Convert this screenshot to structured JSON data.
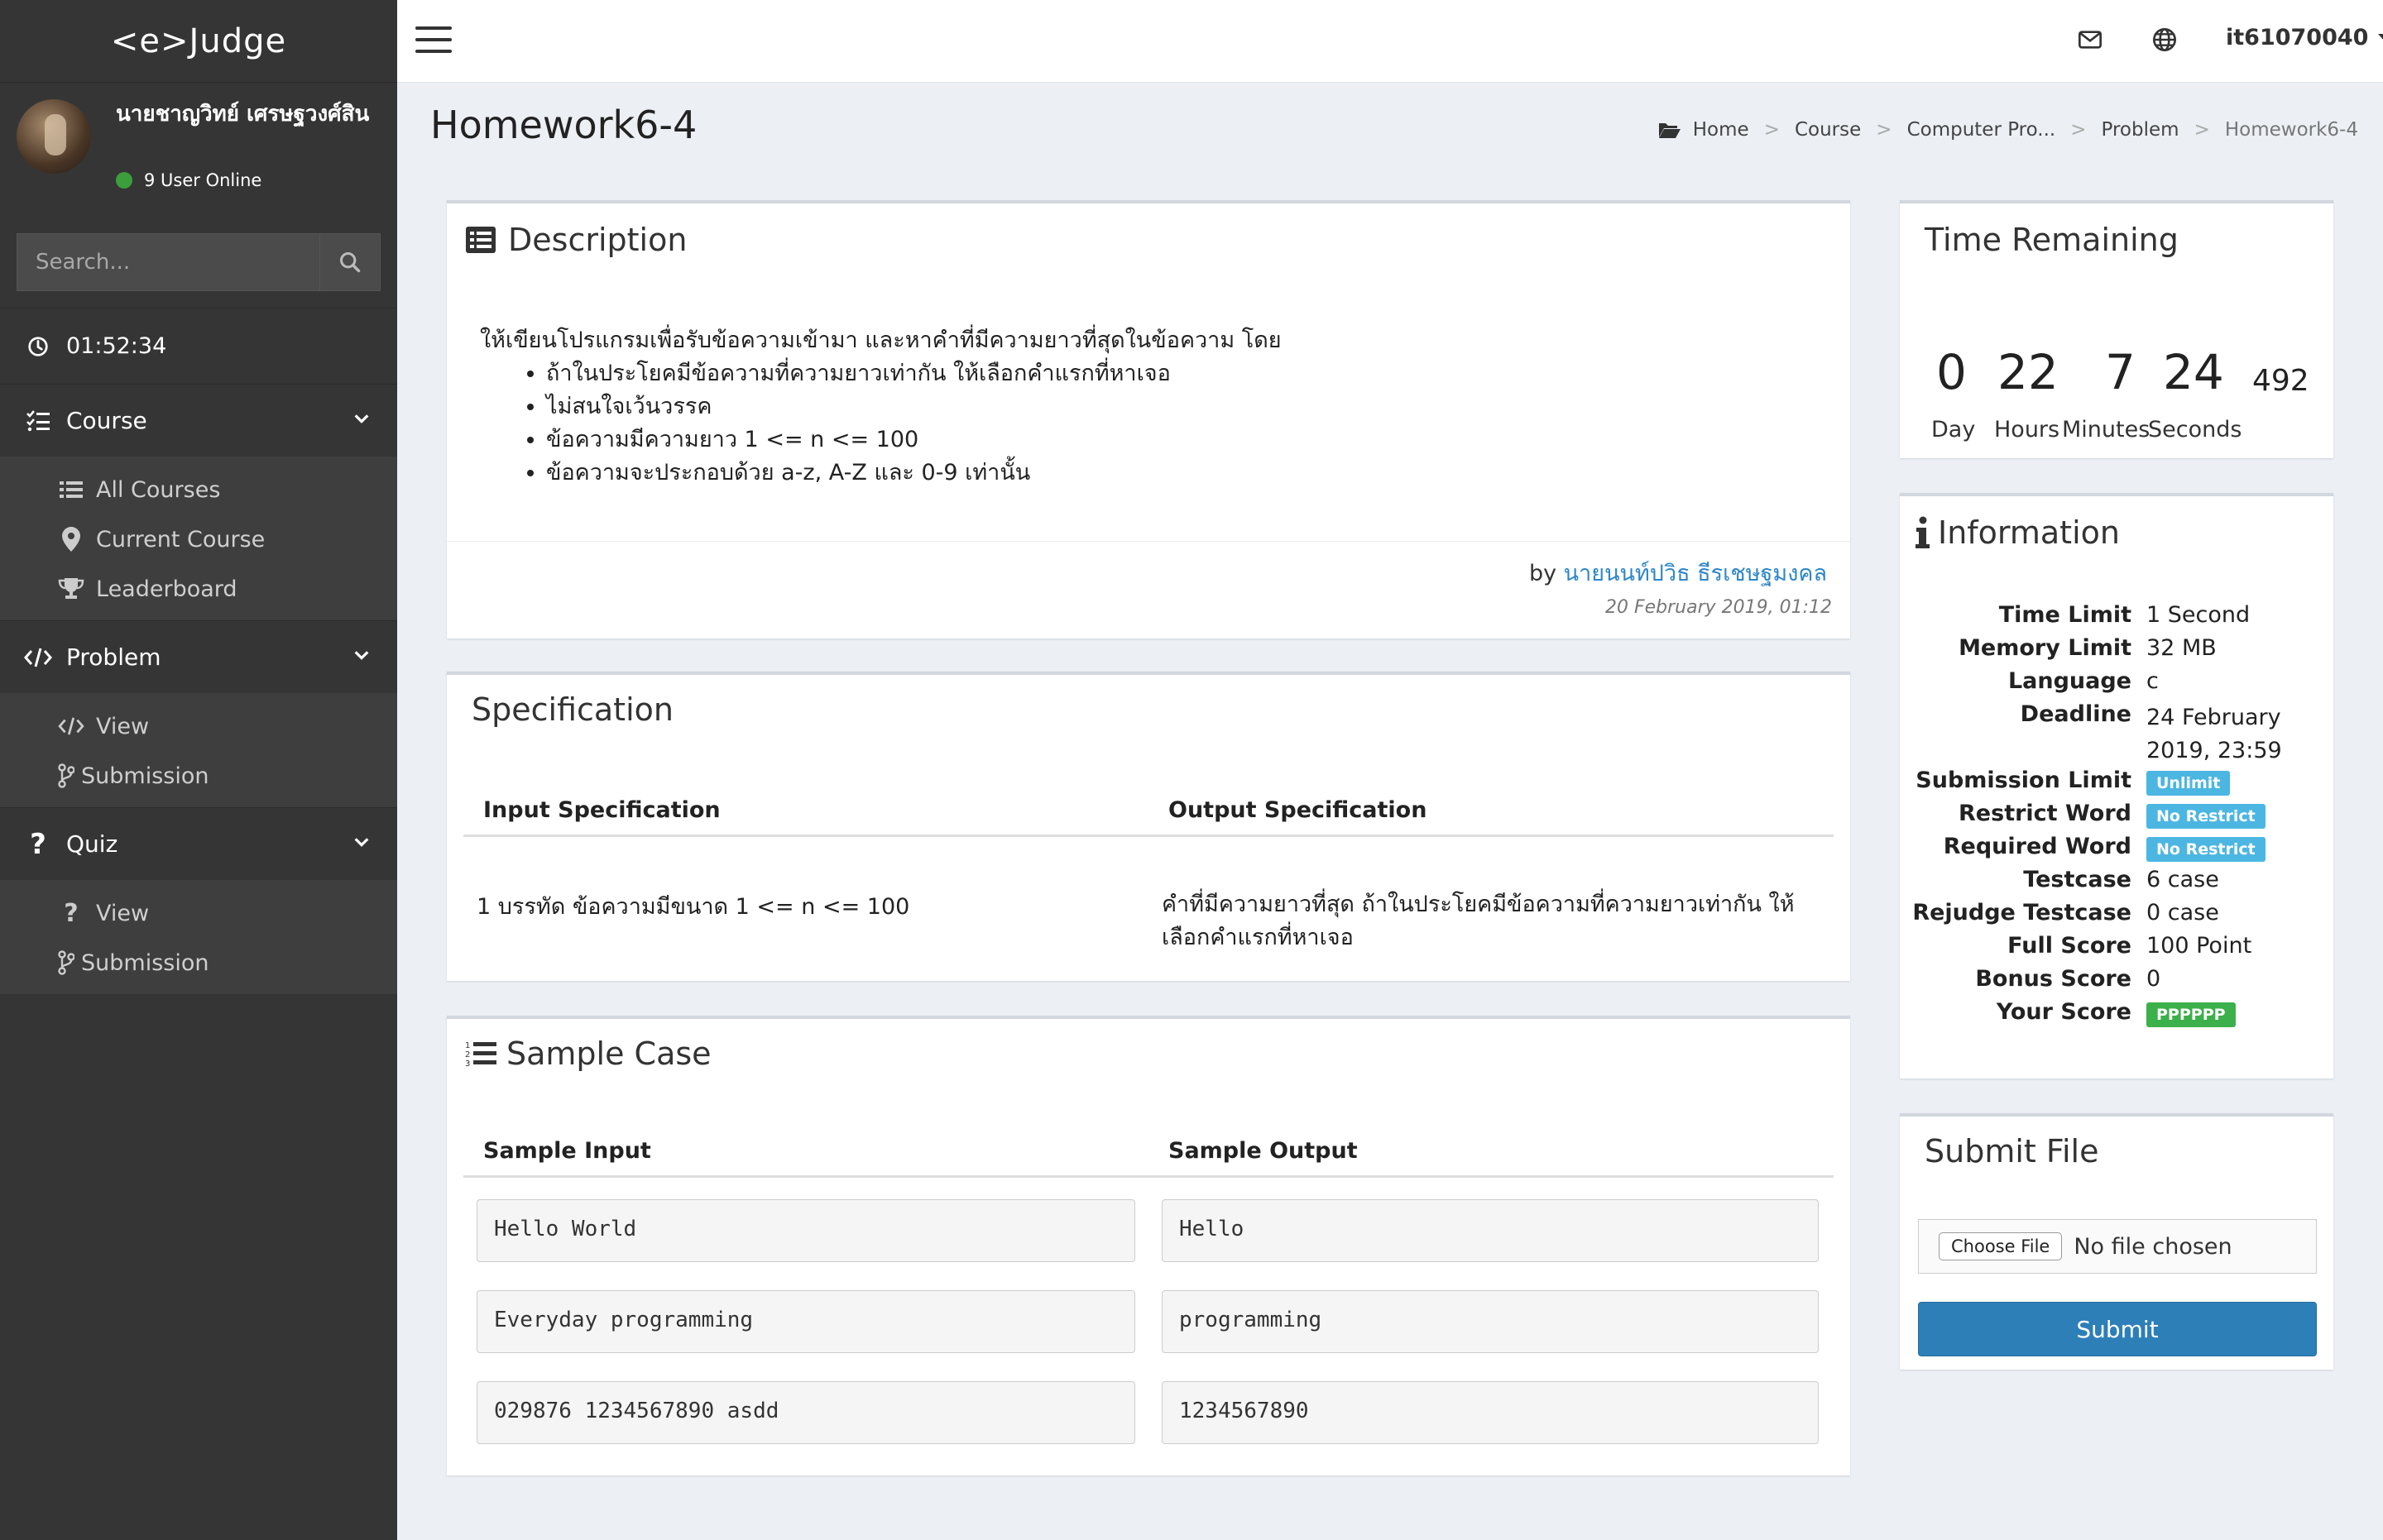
{
  "brand": {
    "logo": "<e>Judge"
  },
  "user": {
    "name": "นายชาญวิทย์ เศรษฐวงศ์สิน",
    "online_text": "9 User Online"
  },
  "search": {
    "placeholder": "Search..."
  },
  "sidebar": {
    "timer": "01:52:34",
    "sections": [
      {
        "label": "Course",
        "items": [
          "All Courses",
          "Current Course",
          "Leaderboard"
        ]
      },
      {
        "label": "Problem",
        "items": [
          "View",
          "Submission"
        ]
      },
      {
        "label": "Quiz",
        "items": [
          "View",
          "Submission"
        ]
      }
    ]
  },
  "topbar": {
    "username": "it61070040"
  },
  "page": {
    "title": "Homework6-4",
    "breadcrumb": [
      "Home",
      "Course",
      "Computer Pro...",
      "Problem",
      "Homework6-4"
    ]
  },
  "description": {
    "title": "Description",
    "intro": "ให้เขียนโปรแกรมเพื่อรับข้อความเข้ามา และหาคำที่มีความยาวที่สุดในข้อความ โดย",
    "bullets": [
      "ถ้าในประโยคมีข้อความที่ความยาวเท่ากัน ให้เลือกคำแรกที่หาเจอ",
      "ไม่สนใจเว้นวรรค",
      "ข้อความมีความยาว 1 <= n <= 100",
      "ข้อความจะประกอบด้วย a-z, A-Z และ 0-9 เท่านั้น"
    ],
    "by_prefix": "by",
    "author": "นายนนท์ปวิธ ธีรเชษฐมงคล",
    "date": "20 February 2019, 01:12"
  },
  "specification": {
    "title": "Specification",
    "input_header": "Input Specification",
    "output_header": "Output Specification",
    "input": "1 บรรทัด ข้อความมีขนาด 1 <= n <= 100",
    "output": "คำที่มีความยาวที่สุด ถ้าในประโยคมีข้อความที่ความยาวเท่ากัน ให้เลือกคำแรกที่หาเจอ"
  },
  "sample": {
    "title": "Sample Case",
    "input_header": "Sample Input",
    "output_header": "Sample Output",
    "cases": [
      {
        "input": "Hello World",
        "output": "Hello"
      },
      {
        "input": "Everyday programming",
        "output": "programming"
      },
      {
        "input": "029876 1234567890 asdd",
        "output": "1234567890"
      }
    ]
  },
  "time_remaining": {
    "title": "Time Remaining",
    "day": "0",
    "hours": "22",
    "minutes": "7",
    "seconds": "24",
    "ms": "492",
    "labels": {
      "day": "Day",
      "hours": "Hours",
      "minutes": "Minutes",
      "seconds": "Seconds"
    }
  },
  "information": {
    "title": "Information",
    "rows": [
      {
        "key": "Time Limit",
        "value": "1 Second"
      },
      {
        "key": "Memory Limit",
        "value": "32 MB"
      },
      {
        "key": "Language",
        "value": "c"
      },
      {
        "key": "Deadline",
        "value": "24 February 2019, 23:59"
      },
      {
        "key": "Submission Limit",
        "value": "Unlimit"
      },
      {
        "key": "Restrict Word",
        "value": "No Restrict"
      },
      {
        "key": "Required Word",
        "value": "No Restrict"
      },
      {
        "key": "Testcase",
        "value": "6 case"
      },
      {
        "key": "Rejudge Testcase",
        "value": "0 case"
      },
      {
        "key": "Full Score",
        "value": "100 Point"
      },
      {
        "key": "Bonus Score",
        "value": "0"
      },
      {
        "key": "Your Score",
        "value": "PPPPPP"
      }
    ]
  },
  "submit": {
    "title": "Submit File",
    "choose_label": "Choose File",
    "no_file": "No file chosen",
    "button": "Submit"
  },
  "colors": {
    "sidebar": "#353535",
    "accent": "#2d7fb8",
    "label_info": "#4cb6e2",
    "label_ok": "#3cb04a",
    "link": "#2e86c9"
  }
}
